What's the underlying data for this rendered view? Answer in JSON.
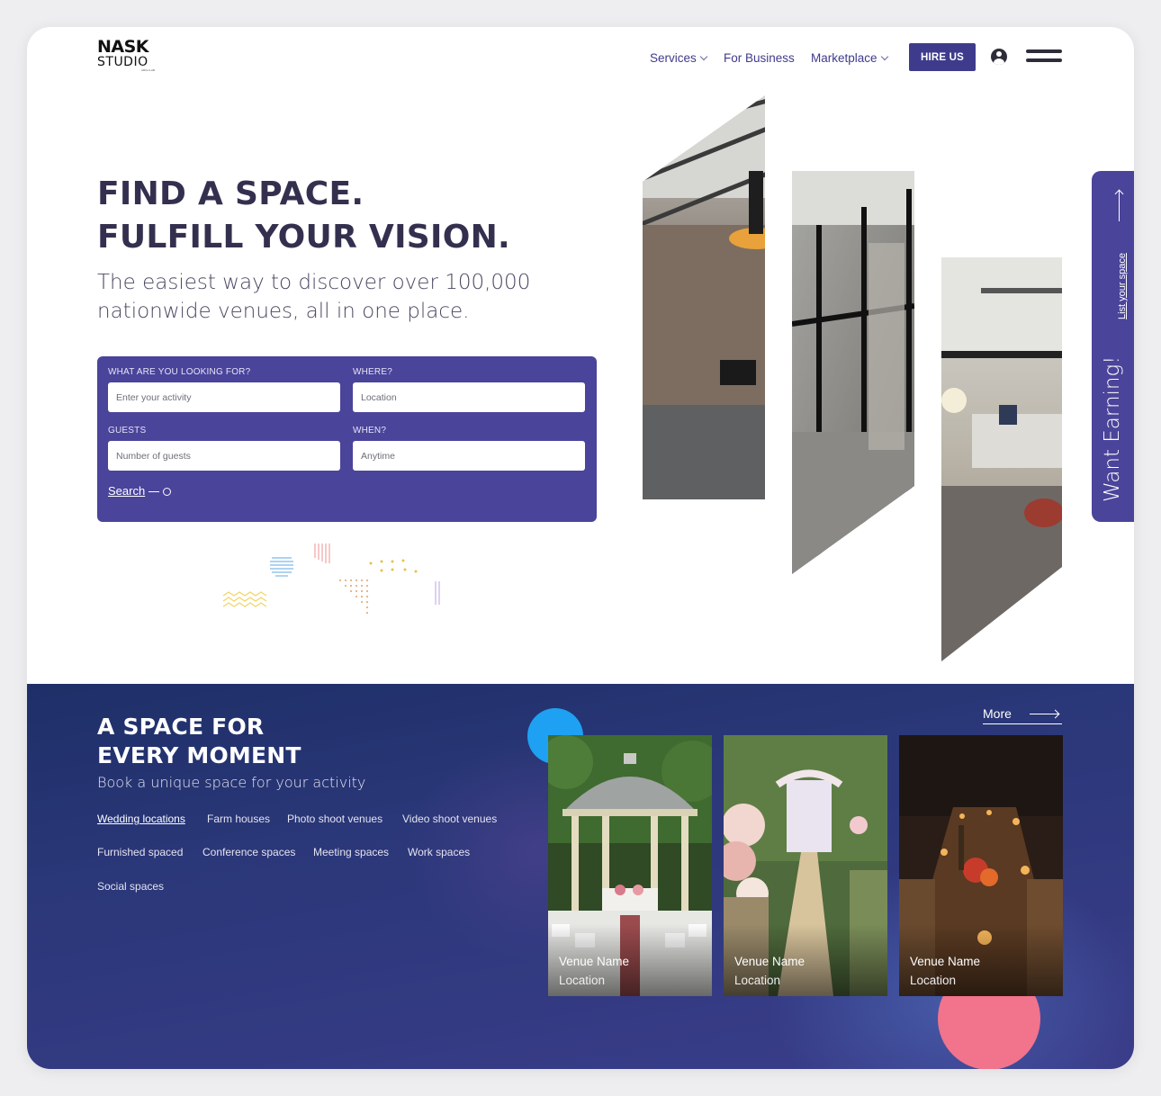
{
  "header": {
    "logo_line1": "NASK",
    "logo_line2": "STUDIO",
    "logo_line3": "ARCH LAB",
    "nav": [
      {
        "label": "Services",
        "dropdown": true
      },
      {
        "label": "For Business",
        "dropdown": false
      },
      {
        "label": "Marketplace",
        "dropdown": true
      }
    ],
    "cta_label": "HIRE US",
    "icons": [
      "user-icon",
      "hamburger-menu-icon"
    ]
  },
  "hero": {
    "title_line1": "FIND A SPACE.",
    "title_line2": "FULFILL YOUR VISION.",
    "subtitle": "The easiest way to discover over 100,000 nationwide venues, all in one place."
  },
  "search": {
    "activity_label": "WHAT ARE YOU LOOKING FOR?",
    "activity_placeholder": "Enter your activity",
    "where_label": "WHERE?",
    "where_placeholder": "Location",
    "guests_label": "GUESTS",
    "guests_placeholder": "Number of guests",
    "when_label": "WHEN?",
    "when_placeholder": "Anytime",
    "submit_label": "Search"
  },
  "side_tab": {
    "title": "Want Earning!",
    "link": "List your space"
  },
  "section": {
    "title_line1": "A SPACE FOR",
    "title_line2": "EVERY MOMENT",
    "subtitle": "Book a unique space for your activity",
    "more_label": "More",
    "tags": [
      "Wedding locations",
      "Farm houses",
      "Photo shoot venues",
      "Video shoot venues",
      "Furnished spaced",
      "Conference spaces",
      "Meeting spaces",
      "Work spaces",
      "Social spaces"
    ],
    "active_tag": "Wedding locations",
    "cards": [
      {
        "name": "Venue Name",
        "location": "Location"
      },
      {
        "name": "Venue Name",
        "location": "Location"
      },
      {
        "name": "Venue Name",
        "location": "Location"
      }
    ]
  },
  "colors": {
    "primary": "#4a449a",
    "nav_text": "#3f3b8c",
    "heading": "#33304f",
    "section_bg": "#2a3778",
    "accent_blue": "#1ea1f2",
    "accent_pink": "#f1738c"
  }
}
